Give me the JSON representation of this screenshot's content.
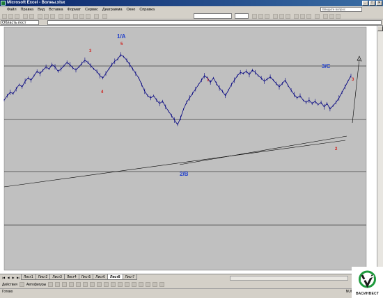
{
  "window": {
    "title": "Microsoft Excel - Волны.xlsх"
  },
  "window_buttons": {
    "minimize": "_",
    "maximize": "□",
    "close": "×"
  },
  "menu": [
    "Файл",
    "Правка",
    "Вид",
    "Вставка",
    "Формат",
    "Сервис",
    "Диаграмма",
    "Окно",
    "Справка"
  ],
  "help_search": {
    "placeholder": "Введите вопрос"
  },
  "formula": {
    "name_box": "Область пост"
  },
  "sheet_tabs": [
    "Лист1",
    "Лист2",
    "Лист3",
    "Лист4",
    "Лист5",
    "Лист6",
    "Лист8",
    "Лист7"
  ],
  "active_sheet": "Лист8",
  "drawing_toolbar": {
    "actions": "Действия",
    "autoshapes": "Автофигуры"
  },
  "status": {
    "ready": "Готово",
    "num": "NUM"
  },
  "wave_labels": {
    "major_1a": "1/A",
    "major_2b": "2/B",
    "major_3c": "3/C",
    "minor_3": "3",
    "minor_4": "4",
    "minor_5": "5",
    "sub_1": "1",
    "sub_2": "2",
    "sub_3": "3"
  },
  "logo": {
    "text": "ВАСИНВЕСТ"
  },
  "colors": {
    "chart_bg": "#c0c0c0",
    "price_line": "#000080",
    "major_label": "#1f3fcc",
    "minor_label": "#d0201b"
  },
  "chart_data": {
    "type": "line",
    "title": "",
    "xlabel": "",
    "ylabel": "",
    "grid": "horizontal",
    "series": [
      {
        "values": [
          58,
          62,
          65,
          64,
          68,
          72,
          70,
          75,
          78,
          76,
          80,
          84,
          82,
          85,
          88,
          86,
          90,
          88,
          84,
          86,
          89,
          92,
          90,
          87,
          85,
          88,
          91,
          94,
          92,
          89,
          86,
          84,
          80,
          78,
          82,
          86,
          90,
          93,
          95,
          99,
          97,
          94,
          90,
          86,
          82,
          78,
          72,
          66,
          62,
          60,
          62,
          58,
          55,
          57,
          52,
          48,
          44,
          40,
          36,
          42,
          50,
          56,
          60,
          64,
          68,
          72,
          76,
          80,
          78,
          74,
          78,
          73,
          69,
          66,
          62,
          67,
          72,
          76,
          80,
          83,
          82,
          84,
          81,
          85,
          83,
          80,
          78,
          75,
          77,
          79,
          76,
          73,
          70,
          73,
          76,
          71,
          67,
          63,
          60,
          62,
          58,
          56,
          58,
          55,
          57,
          54,
          56,
          52,
          55,
          50,
          53,
          56,
          60,
          65,
          70,
          75,
          80
        ]
      }
    ]
  }
}
